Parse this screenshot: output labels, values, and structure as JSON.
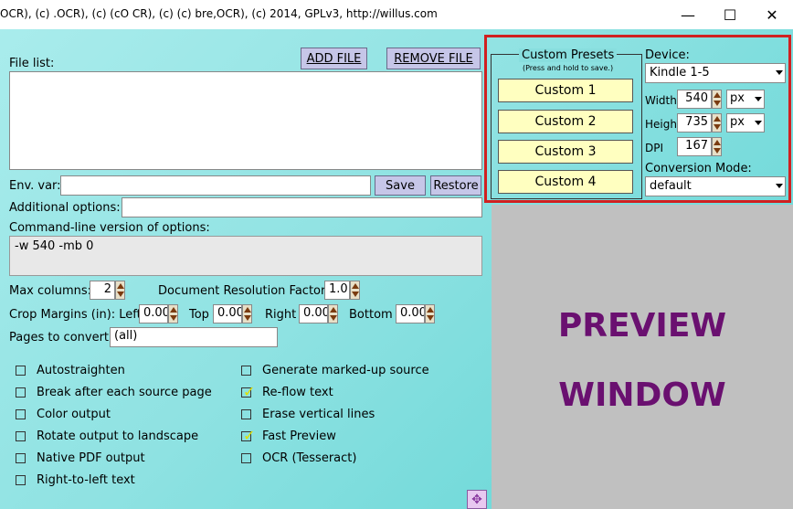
{
  "window": {
    "title": "OCR), (c)  .OCR), (c) (cO CR), (c) (c) bre,OCR), (c) 2014, GPLv3, http://willus.com",
    "minimize_glyph": "—",
    "maximize_glyph": "☐",
    "close_glyph": "✕"
  },
  "files": {
    "label": "File list:",
    "add_label": "ADD FILE",
    "remove_label": "REMOVE FILE"
  },
  "env": {
    "label": "Env. var:",
    "value": "",
    "save_label": "Save",
    "restore_label": "Restore"
  },
  "additional": {
    "label": "Additional options:",
    "value": ""
  },
  "cmdline": {
    "label": "Command-line version of options:",
    "value": "-w 540 -mb 0"
  },
  "maxcols": {
    "label": "Max columns:",
    "value": "2"
  },
  "docres": {
    "label": "Document Resolution Factor:",
    "value": "1.0"
  },
  "crop": {
    "label": "Crop Margins (in): Left",
    "left": "0.00",
    "top_label": "Top",
    "top": "0.00",
    "right_label": "Right",
    "right": "0.00",
    "bottom_label": "Bottom",
    "bottom": "0.00"
  },
  "pages": {
    "label": "Pages to convert:",
    "value": "(all)"
  },
  "checks_left": [
    {
      "label": "Autostraighten",
      "checked": false
    },
    {
      "label": "Break after each source page",
      "checked": false
    },
    {
      "label": "Color output",
      "checked": false
    },
    {
      "label": "Rotate output to landscape",
      "checked": false
    },
    {
      "label": "Native PDF output",
      "checked": false
    },
    {
      "label": "Right-to-left text",
      "checked": false
    }
  ],
  "checks_right": [
    {
      "label": "Generate marked-up source",
      "checked": false
    },
    {
      "label": "Re-flow text",
      "checked": true
    },
    {
      "label": "Erase vertical lines",
      "checked": false
    },
    {
      "label": "Fast Preview",
      "checked": true
    },
    {
      "label": "OCR (Tesseract)",
      "checked": false
    }
  ],
  "presets": {
    "title": "Custom Presets",
    "hint": "(Press and hold to save.)",
    "buttons": [
      "Custom 1",
      "Custom 2",
      "Custom 3",
      "Custom 4"
    ]
  },
  "device": {
    "label": "Device:",
    "value": "Kindle 1-5",
    "width_label": "Width",
    "width": "540",
    "width_unit": "px",
    "height_label": "Height",
    "height": "735",
    "height_unit": "px",
    "dpi_label": "DPI",
    "dpi": "167",
    "mode_label": "Conversion Mode:",
    "mode": "default"
  },
  "preview": {
    "line1": "PREVIEW",
    "line2": "WINDOW"
  },
  "colors": {
    "highlight_border": "#d02020",
    "preview_text": "#6a1070",
    "preset_bg": "#ffffc0"
  }
}
